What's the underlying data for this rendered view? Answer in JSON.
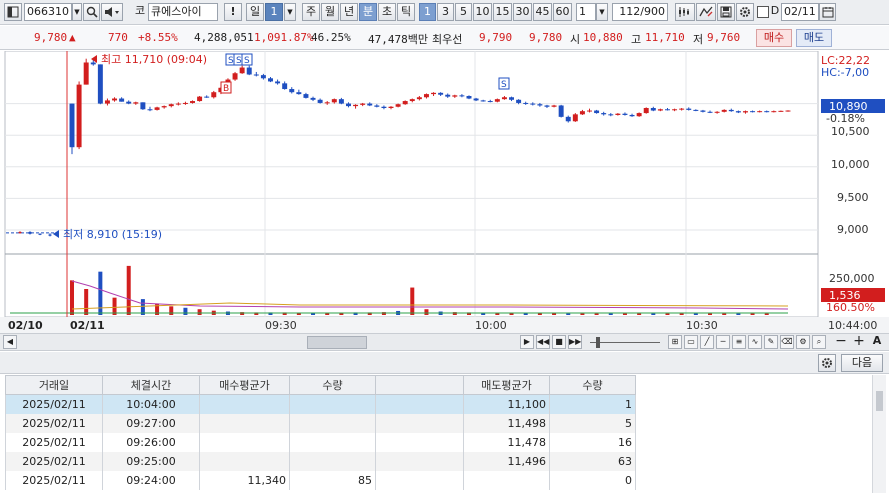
{
  "toolbar": {
    "stock_code": "066310",
    "market": "코",
    "stock_name": "큐에스아이",
    "alert": "!",
    "period_day": "일",
    "period_value": "1",
    "period_week": "주",
    "period_month": "월",
    "period_year": "년",
    "period_minute": "분",
    "period_second": "초",
    "period_tick": "틱",
    "minute_options": [
      "1",
      "3",
      "5",
      "10",
      "15",
      "30",
      "45",
      "60"
    ],
    "interval_value": "1",
    "bar_count": "112",
    "bar_total": "/900",
    "date_checkbox_label": "D",
    "date_value": "02/11"
  },
  "quote": {
    "price": "9,780",
    "change_arrow": "▲",
    "change": "770",
    "change_pct": "+8.55%",
    "volume": "4,288,051",
    "volume_ratio": "1,091.87%",
    "turnover": "46.25%",
    "amount": "47,478백만",
    "best_ask_label": "최우선",
    "best_ask": "9,790",
    "best_bid": "9,780",
    "open_label": "시",
    "open": "10,880",
    "high_label": "고",
    "high": "11,710",
    "low_label": "저",
    "low": "9,760",
    "buy_button": "매수",
    "sell_button": "매도"
  },
  "chart": {
    "high_marker": "최고 11,710 (09:04)",
    "low_marker": "최저 8,910 (15:19)",
    "lc_label": "LC:22,22",
    "hc_label": "HC:-7,00",
    "current_price": "10,890",
    "current_pct": "-0.18%",
    "price_ticks": [
      "10,500",
      "10,000",
      "9,500",
      "9,000"
    ],
    "volume_ticks": [
      "250,000"
    ],
    "volume_current": "1,536",
    "volume_pct": "160.50%",
    "x_labels_left": [
      "02/10",
      "02/11"
    ],
    "x_labels": [
      "09:30",
      "10:00",
      "10:30"
    ],
    "x_end_time": "10:44:00",
    "signal_labels": [
      "S",
      "S",
      "S",
      "B",
      "S"
    ],
    "colors": {
      "up": "#d21e1e",
      "down": "#1f4fc1",
      "accent": "#e02020"
    },
    "candles": [
      [
        11000,
        11000,
        10200,
        10310
      ],
      [
        10310,
        11350,
        10280,
        11300
      ],
      [
        11300,
        11710,
        11300,
        11650
      ],
      [
        11650,
        11710,
        11600,
        11620
      ],
      [
        11620,
        11620,
        10990,
        11000
      ],
      [
        11000,
        11080,
        10970,
        11050
      ],
      [
        11050,
        11100,
        11030,
        11080
      ],
      [
        11080,
        11100,
        11030,
        11030
      ],
      [
        11030,
        11050,
        10990,
        11000
      ],
      [
        11000,
        11030,
        10980,
        11020
      ],
      [
        11020,
        11020,
        10900,
        10910
      ],
      [
        10910,
        10950,
        10880,
        10900
      ],
      [
        10900,
        10950,
        10890,
        10940
      ],
      [
        10940,
        10970,
        10920,
        10960
      ],
      [
        10960,
        11000,
        10940,
        10990
      ],
      [
        10990,
        11020,
        10970,
        11000
      ],
      [
        11000,
        11030,
        10980,
        11010
      ],
      [
        11010,
        11050,
        11000,
        11040
      ],
      [
        11040,
        11120,
        11030,
        11110
      ],
      [
        11110,
        11130,
        11090,
        11100
      ],
      [
        11100,
        11200,
        11080,
        11180
      ],
      [
        11180,
        11260,
        11150,
        11250
      ],
      [
        11250,
        11400,
        11230,
        11380
      ],
      [
        11380,
        11500,
        11360,
        11480
      ],
      [
        11480,
        11600,
        11470,
        11570
      ],
      [
        11570,
        11600,
        11450,
        11460
      ],
      [
        11460,
        11500,
        11430,
        11450
      ],
      [
        11450,
        11470,
        11380,
        11400
      ],
      [
        11400,
        11420,
        11340,
        11350
      ],
      [
        11350,
        11380,
        11300,
        11320
      ],
      [
        11320,
        11350,
        11220,
        11230
      ],
      [
        11230,
        11260,
        11160,
        11180
      ],
      [
        11180,
        11220,
        11140,
        11150
      ],
      [
        11150,
        11170,
        11080,
        11090
      ],
      [
        11090,
        11110,
        11040,
        11060
      ],
      [
        11060,
        11080,
        11000,
        11010
      ],
      [
        11010,
        11040,
        10980,
        11020
      ],
      [
        11020,
        11080,
        11000,
        11070
      ],
      [
        11070,
        11090,
        10990,
        11000
      ],
      [
        11000,
        11020,
        10940,
        10960
      ],
      [
        10960,
        10990,
        10920,
        10980
      ],
      [
        10980,
        11010,
        10960,
        11000
      ],
      [
        11000,
        11020,
        10960,
        10970
      ],
      [
        10970,
        10990,
        10940,
        10950
      ],
      [
        10950,
        10970,
        10910,
        10930
      ],
      [
        10930,
        10960,
        10910,
        10950
      ],
      [
        10950,
        11000,
        10940,
        10990
      ],
      [
        10990,
        11050,
        10980,
        11040
      ],
      [
        11040,
        11080,
        11020,
        11070
      ],
      [
        11070,
        11120,
        11050,
        11100
      ],
      [
        11100,
        11160,
        11080,
        11150
      ],
      [
        11150,
        11180,
        11120,
        11170
      ],
      [
        11170,
        11180,
        11120,
        11140
      ],
      [
        11140,
        11160,
        11090,
        11110
      ],
      [
        11110,
        11140,
        11090,
        11130
      ],
      [
        11130,
        11150,
        11100,
        11120
      ],
      [
        11120,
        11130,
        11070,
        11080
      ],
      [
        11080,
        11090,
        11040,
        11050
      ],
      [
        11050,
        11060,
        11030,
        11040
      ],
      [
        11040,
        11060,
        11020,
        11030
      ],
      [
        11030,
        11080,
        11020,
        11070
      ],
      [
        11070,
        11120,
        11060,
        11100
      ],
      [
        11100,
        11110,
        11040,
        11060
      ],
      [
        11060,
        11070,
        10990,
        11010
      ],
      [
        11010,
        11030,
        10980,
        11000
      ],
      [
        11000,
        11020,
        10970,
        10990
      ],
      [
        10990,
        11010,
        10950,
        10970
      ],
      [
        10970,
        10980,
        10930,
        10950
      ],
      [
        10950,
        10980,
        10940,
        10970
      ],
      [
        10970,
        10980,
        10780,
        10790
      ],
      [
        10790,
        10810,
        10700,
        10720
      ],
      [
        10720,
        10850,
        10710,
        10830
      ],
      [
        10830,
        10900,
        10820,
        10880
      ],
      [
        10880,
        10920,
        10860,
        10890
      ],
      [
        10890,
        10900,
        10840,
        10850
      ],
      [
        10850,
        10870,
        10810,
        10830
      ],
      [
        10830,
        10850,
        10800,
        10820
      ],
      [
        10820,
        10850,
        10810,
        10840
      ],
      [
        10840,
        10860,
        10810,
        10820
      ],
      [
        10820,
        10840,
        10790,
        10800
      ],
      [
        10800,
        10860,
        10790,
        10850
      ],
      [
        10850,
        10940,
        10840,
        10930
      ],
      [
        10930,
        10950,
        10880,
        10890
      ],
      [
        10890,
        10920,
        10880,
        10910
      ],
      [
        10910,
        10930,
        10890,
        10900
      ],
      [
        10900,
        10920,
        10880,
        10910
      ],
      [
        10910,
        10930,
        10890,
        10920
      ],
      [
        10920,
        10940,
        10890,
        10900
      ],
      [
        10900,
        10910,
        10880,
        10890
      ],
      [
        10890,
        10900,
        10860,
        10870
      ],
      [
        10870,
        10890,
        10850,
        10860
      ],
      [
        10860,
        10880,
        10840,
        10870
      ],
      [
        10870,
        10910,
        10860,
        10900
      ],
      [
        10900,
        10920,
        10870,
        10880
      ],
      [
        10880,
        10890,
        10850,
        10860
      ],
      [
        10860,
        10890,
        10840,
        10880
      ],
      [
        10880,
        10890,
        10860,
        10870
      ],
      [
        10870,
        10890,
        10860,
        10880
      ],
      [
        10880,
        10890,
        10860,
        10870
      ],
      [
        10870,
        10890,
        10860,
        10880
      ],
      [
        10880,
        10890,
        10870,
        10885
      ],
      [
        10885,
        10895,
        10870,
        10890
      ]
    ],
    "prev_day": [
      [
        8960,
        8980,
        8940,
        8970
      ],
      [
        8970,
        8980,
        8930,
        8940
      ],
      [
        8940,
        8950,
        8920,
        8930
      ],
      [
        8930,
        8950,
        8900,
        8910
      ]
    ],
    "volumes": [
      120000,
      90000,
      150000,
      60000,
      170000,
      55000,
      40000,
      30000,
      25000,
      20000,
      15000,
      12000,
      10000,
      9000,
      9000,
      9000,
      8000,
      8000,
      8000,
      8000,
      9000,
      9000,
      10000,
      14000,
      95000,
      20000,
      12000,
      10000,
      9000,
      8000,
      7000,
      7000,
      6000,
      6000,
      6000,
      5000,
      5000,
      5000,
      5000,
      5000,
      5000,
      5000,
      5000,
      5000,
      5000,
      5000,
      5000,
      5000,
      5000,
      5000
    ]
  },
  "navigation": {
    "zoom_in": "+",
    "zoom_out": "−",
    "auto_label": "A"
  },
  "trades": {
    "next_button": "다음",
    "headers": [
      "거래일",
      "체결시간",
      "매수평균가",
      "수량",
      "",
      "매도평균가",
      "수량"
    ],
    "rows": [
      [
        "2025/02/11",
        "10:04:00",
        "",
        "",
        "",
        "11,100",
        "1"
      ],
      [
        "2025/02/11",
        "09:27:00",
        "",
        "",
        "",
        "11,498",
        "5"
      ],
      [
        "2025/02/11",
        "09:26:00",
        "",
        "",
        "",
        "11,478",
        "16"
      ],
      [
        "2025/02/11",
        "09:25:00",
        "",
        "",
        "",
        "11,496",
        "63"
      ],
      [
        "2025/02/11",
        "09:24:00",
        "11,340",
        "85",
        "",
        "",
        "0"
      ]
    ]
  }
}
